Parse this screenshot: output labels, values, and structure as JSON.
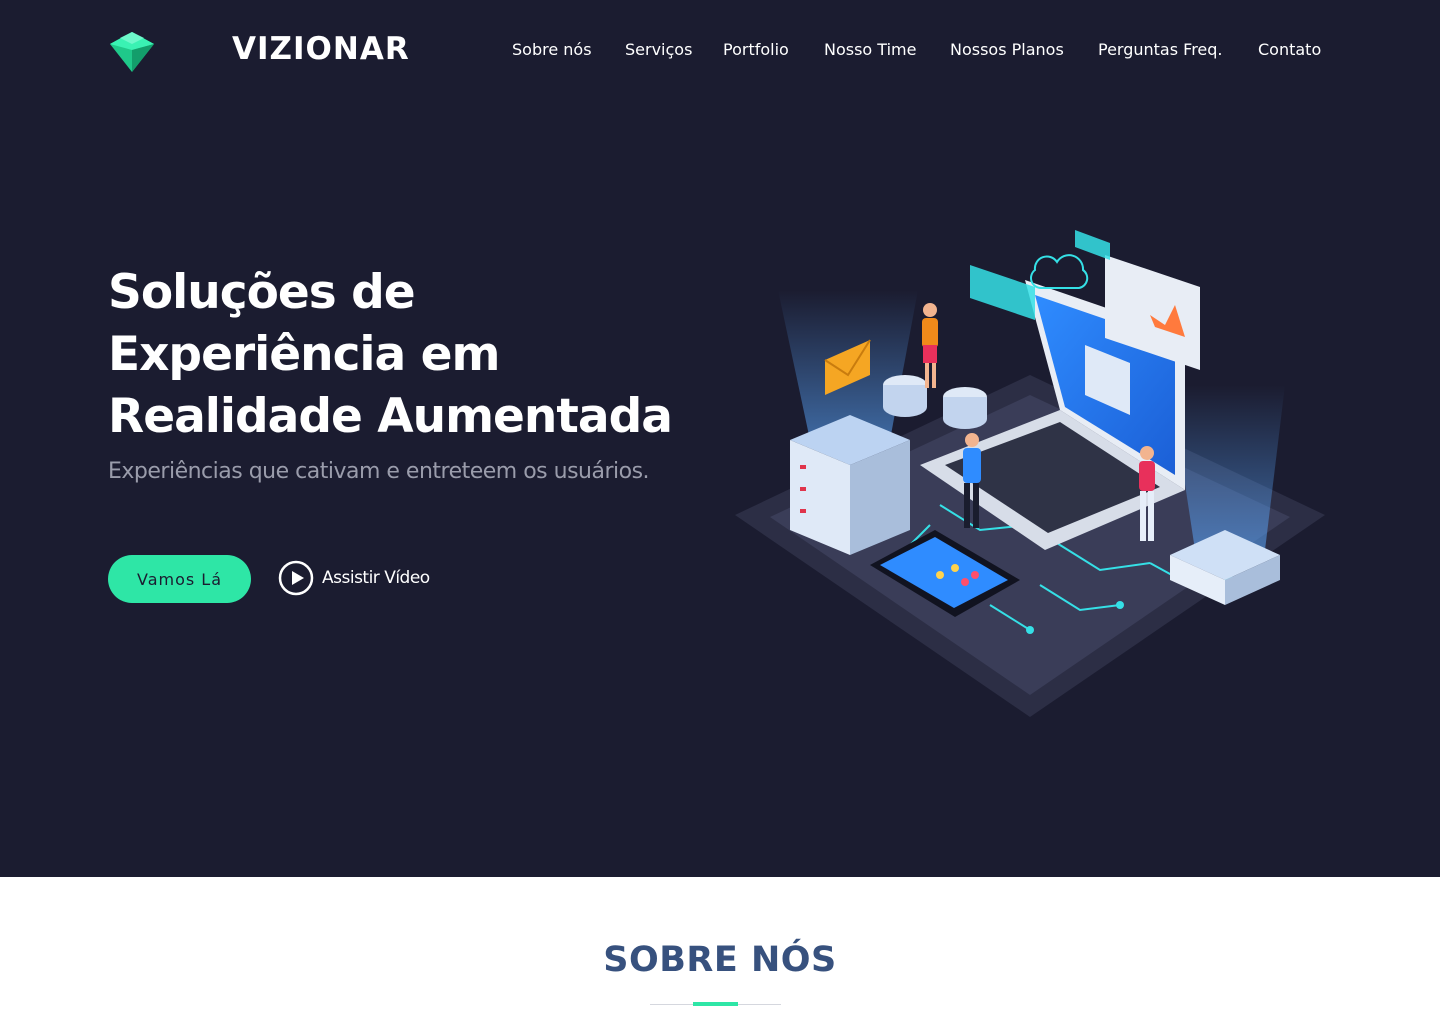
{
  "header": {
    "brand": "VIZIONAR",
    "logo_icon": "diamond-icon",
    "nav": [
      {
        "label": "Sobre nós",
        "active": true
      },
      {
        "label": "Serviços",
        "active": false
      },
      {
        "label": "Portfolio",
        "active": false
      },
      {
        "label": "Nosso Time",
        "active": false
      },
      {
        "label": "Nossos Planos",
        "active": false
      },
      {
        "label": "Perguntas Freq.",
        "active": false
      },
      {
        "label": "Contato",
        "active": false
      }
    ]
  },
  "hero": {
    "title_lines": [
      "Soluções de",
      "Experiência em",
      "Realidade Aumentada"
    ],
    "subtitle": "Experiências que cativam e entreteem os usuários.",
    "cta_label": "Vamos Lá",
    "video_label": "Assistir Vídeo",
    "video_icon": "play-circle-icon"
  },
  "about": {
    "title": "SOBRE NÓS"
  },
  "colors": {
    "hero_bg": "#1b1c30",
    "accent": "#2ee6a6",
    "section_title": "#37517e",
    "subtitle": "#9a9cab"
  }
}
